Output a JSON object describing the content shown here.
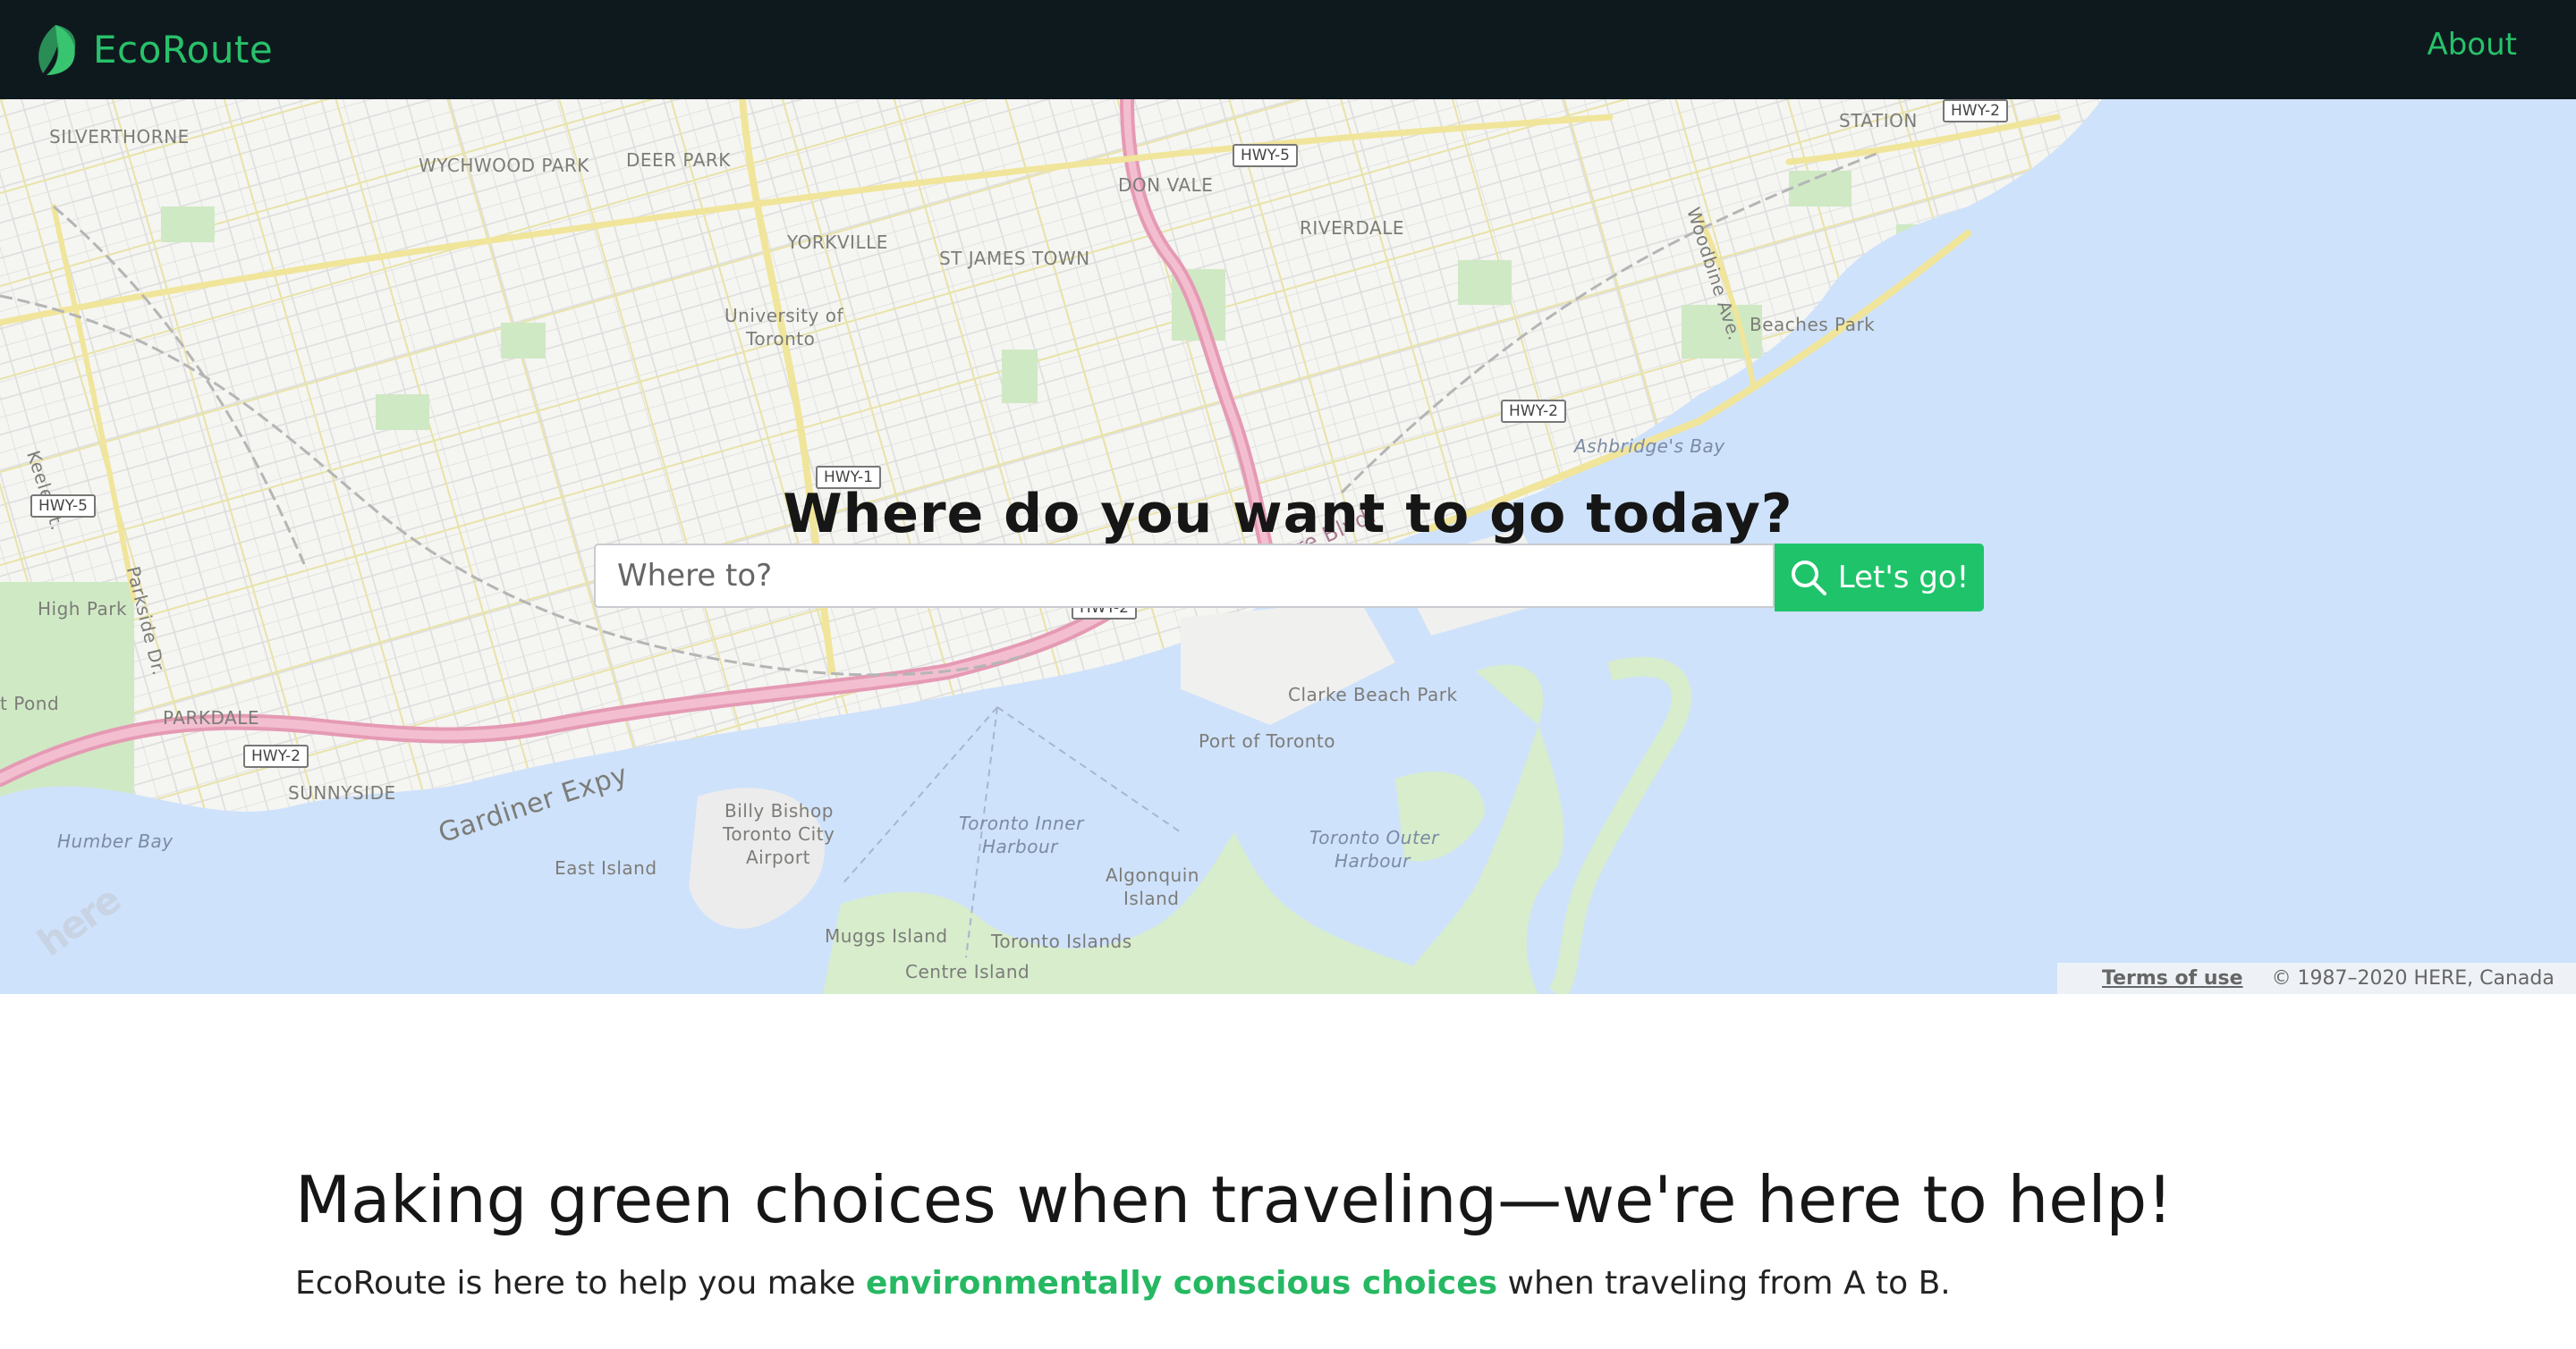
{
  "nav": {
    "brand": "EcoRoute",
    "about_label": "About"
  },
  "colors": {
    "brand_green": "#28c16a",
    "nav_bg": "#0e191e",
    "button_green": "#1fc46a",
    "water": "#cfe2fb"
  },
  "map": {
    "labels": {
      "silverthorne": "SILVERTHORNE",
      "wychwood": "WYCHWOOD PARK",
      "deer_park": "DEER PARK",
      "don_vale": "DON VALE",
      "riverdale": "RIVERDALE",
      "yorkville": "YORKVILLE",
      "st_james": "ST JAMES TOWN",
      "uoft": "University of",
      "uoft2": "Toronto",
      "keele": "Keele St.",
      "parkside": "Parkside Dr.",
      "high_park": "High Park",
      "pond": "t Pond",
      "parkdale": "PARKDALE",
      "sunnyside": "SUNNYSIDE",
      "gardiner": "Gardiner Expy",
      "humber_bay": "Humber Bay",
      "east_island": "East Island",
      "billy1": "Billy Bishop",
      "billy2": "Toronto City",
      "billy3": "Airport",
      "inner1": "Toronto Inner",
      "inner2": "Harbour",
      "algonquin1": "Algonquin",
      "algonquin2": "Island",
      "muggs": "Muggs Island",
      "centre": "Centre Island",
      "toronto_islands": "Toronto Islands",
      "outer1": "Toronto Outer",
      "outer2": "Harbour",
      "clarke": "Clarke Beach Park",
      "port": "Port of Toronto",
      "ashbridge": "Ashbridge's Bay",
      "beaches": "Beaches Park",
      "woodbine": "Woodbine Ave.",
      "station": "STATION",
      "lakeshore": "ore Blvd."
    },
    "shields": {
      "hwy5_top": "HWY-5",
      "hwy2_top": "HWY-2",
      "hwy2_east": "HWY-2",
      "hwy5_west": "HWY-5",
      "hwy2_west": "HWY-2",
      "hwy1": "HWY-1",
      "hwy2_mid": "HWY-2"
    },
    "here_logo": "here",
    "terms": "Terms of use",
    "copyright": "© 1987–2020 HERE, Canada"
  },
  "hero": {
    "title": "Where do you want to go today?",
    "search_placeholder": "Where to?",
    "search_value": "",
    "button_label": "Let's go!"
  },
  "content": {
    "heading": "Making green choices when traveling—we're here to help!",
    "body_before": "EcoRoute is here to help you make ",
    "body_highlight": "environmentally conscious choices",
    "body_after": " when traveling from A to B."
  }
}
